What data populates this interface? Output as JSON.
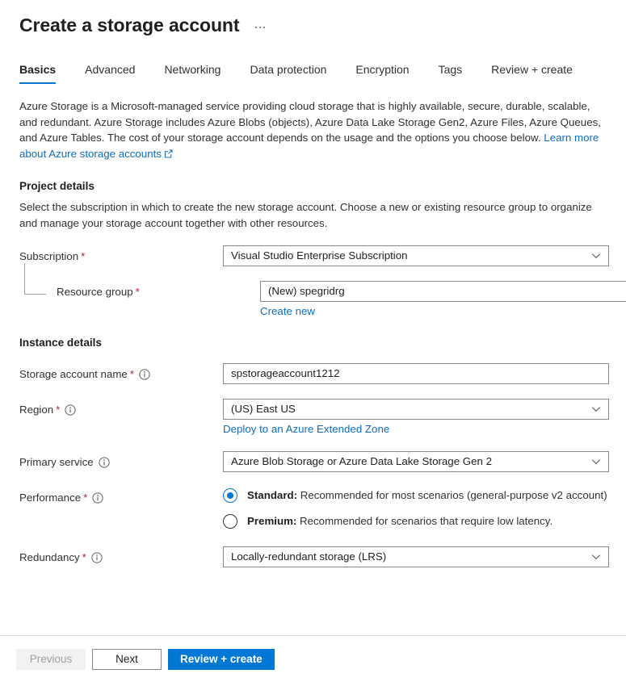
{
  "header": {
    "title": "Create a storage account",
    "more_menu": "…"
  },
  "tabs": [
    {
      "label": "Basics",
      "active": true
    },
    {
      "label": "Advanced",
      "active": false
    },
    {
      "label": "Networking",
      "active": false
    },
    {
      "label": "Data protection",
      "active": false
    },
    {
      "label": "Encryption",
      "active": false
    },
    {
      "label": "Tags",
      "active": false
    },
    {
      "label": "Review + create",
      "active": false
    }
  ],
  "intro": {
    "text": "Azure Storage is a Microsoft-managed service providing cloud storage that is highly available, secure, durable, scalable, and redundant. Azure Storage includes Azure Blobs (objects), Azure Data Lake Storage Gen2, Azure Files, Azure Queues, and Azure Tables. The cost of your storage account depends on the usage and the options you choose below. ",
    "link_text": "Learn more about Azure storage accounts"
  },
  "project_details": {
    "title": "Project details",
    "description": "Select the subscription in which to create the new storage account. Choose a new or existing resource group to organize and manage your storage account together with other resources.",
    "subscription": {
      "label": "Subscription",
      "required": "*",
      "value": "Visual Studio Enterprise Subscription"
    },
    "resource_group": {
      "label": "Resource group",
      "required": "*",
      "value": "(New) spegridrg",
      "create_new_link": "Create new"
    }
  },
  "instance_details": {
    "title": "Instance details",
    "storage_account_name": {
      "label": "Storage account name",
      "required": "*",
      "value": "spstorageaccount1212"
    },
    "region": {
      "label": "Region",
      "required": "*",
      "value": "(US) East US",
      "extended_zone_link": "Deploy to an Azure Extended Zone"
    },
    "primary_service": {
      "label": "Primary service",
      "value": "Azure Blob Storage or Azure Data Lake Storage Gen 2"
    },
    "performance": {
      "label": "Performance",
      "required": "*",
      "options": [
        {
          "name": "Standard:",
          "description": " Recommended for most scenarios (general-purpose v2 account)",
          "selected": true
        },
        {
          "name": "Premium:",
          "description": " Recommended for scenarios that require low latency.",
          "selected": false
        }
      ]
    },
    "redundancy": {
      "label": "Redundancy",
      "required": "*",
      "value": "Locally-redundant storage (LRS)"
    }
  },
  "footer": {
    "previous": "Previous",
    "next": "Next",
    "review_create": "Review + create"
  },
  "colors": {
    "accent": "#0078d4",
    "link": "#0f6cbd",
    "required": "#a4262c",
    "border": "#8a8886"
  }
}
